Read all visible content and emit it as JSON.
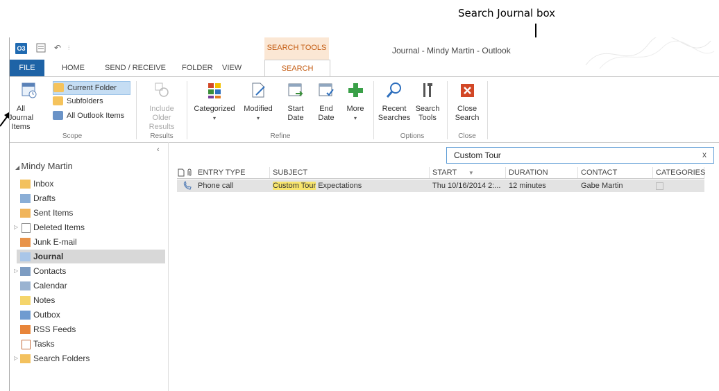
{
  "annotation": {
    "search_callout": "Search Journal box"
  },
  "titlebar": {
    "window_title": "Journal - Mindy Martin - Outlook",
    "context_tab": "SEARCH TOOLS",
    "app_icon": "O3",
    "undo": "↶",
    "qa_more": "⫶"
  },
  "tabs": [
    "FILE",
    "HOME",
    "SEND / RECEIVE",
    "FOLDER",
    "VIEW",
    "SEARCH"
  ],
  "ribbon": {
    "scope": {
      "all_label": "All Journal Items",
      "current_folder": "Current Folder",
      "subfolders": "Subfolders",
      "all_outlook": "All Outlook Items",
      "group": "Scope"
    },
    "results": {
      "include": "Include Older Results",
      "group": "Results"
    },
    "refine": {
      "categorized": "Categorized",
      "modified": "Modified",
      "start_date": "Start Date",
      "end_date": "End Date",
      "more": "More",
      "group": "Refine"
    },
    "options": {
      "recent": "Recent Searches",
      "tools": "Search Tools",
      "group": "Options"
    },
    "close": {
      "label": "Close Search",
      "group": "Close"
    }
  },
  "nav": {
    "account": "Mindy Martin",
    "items": [
      "Inbox",
      "Drafts",
      "Sent Items",
      "Deleted Items",
      "Junk E-mail",
      "Journal",
      "Contacts",
      "Calendar",
      "Notes",
      "Outbox",
      "RSS Feeds",
      "Tasks",
      "Search Folders"
    ]
  },
  "search": {
    "value": "Custom Tour",
    "clear": "x"
  },
  "grid": {
    "headers": [
      "ENTRY TYPE",
      "SUBJECT",
      "START",
      "DURATION",
      "CONTACT",
      "CATEGORIES"
    ],
    "rows": [
      {
        "entry_type": "Phone call",
        "subject_match": "Custom Tour",
        "subject_rest": " Expectations",
        "start": "Thu 10/16/2014 2:...",
        "duration": "12 minutes",
        "contact": "Gabe Martin"
      }
    ]
  },
  "colors": {
    "file_tab": "#1e63a6",
    "search_accent": "#c45c12",
    "highlight": "#f8e56d",
    "close_red": "#d24726"
  }
}
